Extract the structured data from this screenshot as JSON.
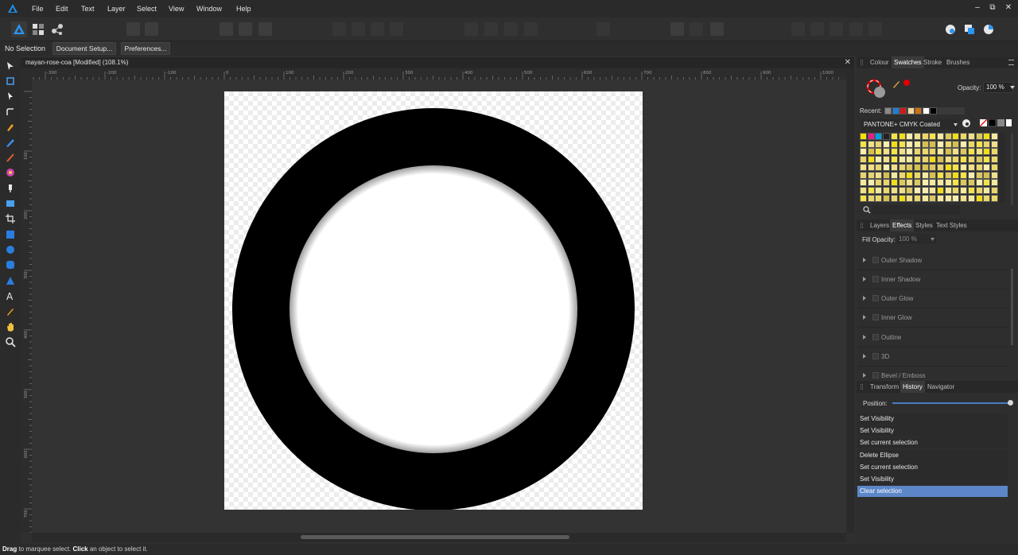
{
  "menubar": {
    "items": [
      "File",
      "Edit",
      "Text",
      "Layer",
      "Select",
      "View",
      "Window",
      "Help"
    ]
  },
  "context": {
    "selection": "No Selection",
    "doc_setup": "Document Setup...",
    "preferences": "Preferences..."
  },
  "document": {
    "tab_title": "mayan-rose-coa [Modified] (108.1%)"
  },
  "ruler": {
    "h_labels": [
      "-300",
      "-200",
      "-100",
      "0",
      "100",
      "200",
      "300",
      "400",
      "500",
      "600",
      "700",
      "800",
      "900",
      "1000"
    ],
    "v_labels": [
      "100",
      "200",
      "300",
      "400",
      "500",
      "600",
      "700"
    ]
  },
  "swatch_panel": {
    "tabs": [
      "Colour",
      "Swatches",
      "Stroke",
      "Brushes"
    ],
    "active_tab": "Swatches",
    "opacity_label": "Opacity:",
    "opacity_value": "100 %",
    "recent_label": "Recent:",
    "recent_colors": [
      "#8a8a8a",
      "#1e7fd6",
      "#d01818",
      "#f0d8a0",
      "#d07010",
      "#ffffff",
      "#000000"
    ],
    "palette_name": "PANTONE+ CMYK Coated",
    "fill_color": "#e00000",
    "palette_colors": [
      "#f5e100",
      "#e0218a",
      "#00a0e0",
      "#222222",
      "#f3eaa0",
      "#f7eeb0",
      "#f0e08a",
      "#ebd86a",
      "#f4e34a",
      "#f1dd1a",
      "#e8d470",
      "#dcc860",
      "#d6c050"
    ]
  },
  "effects_panel": {
    "tabs": [
      "Layers",
      "Effects",
      "Styles",
      "Text Styles"
    ],
    "active_tab": "Effects",
    "fill_opacity_label": "Fill Opacity:",
    "fill_opacity_value": "100 %",
    "effects": [
      "Outer Shadow",
      "Inner Shadow",
      "Outer Glow",
      "Inner Glow",
      "Outline",
      "3D",
      "Bevel / Emboss"
    ]
  },
  "history_panel": {
    "tabs": [
      "Transform",
      "History",
      "Navigator"
    ],
    "active_tab": "History",
    "position_label": "Position:",
    "position": 1.0,
    "entries": [
      "Set Visibility",
      "Set Visibility",
      "Set current selection",
      "Delete Ellipse",
      "Set current selection",
      "Set Visibility",
      "Clear selection"
    ],
    "selected_index": 6
  },
  "status": {
    "drag_word": "Drag",
    "drag_text": " to marquee select. ",
    "click_word": "Click",
    "click_text": " an object to select it."
  }
}
